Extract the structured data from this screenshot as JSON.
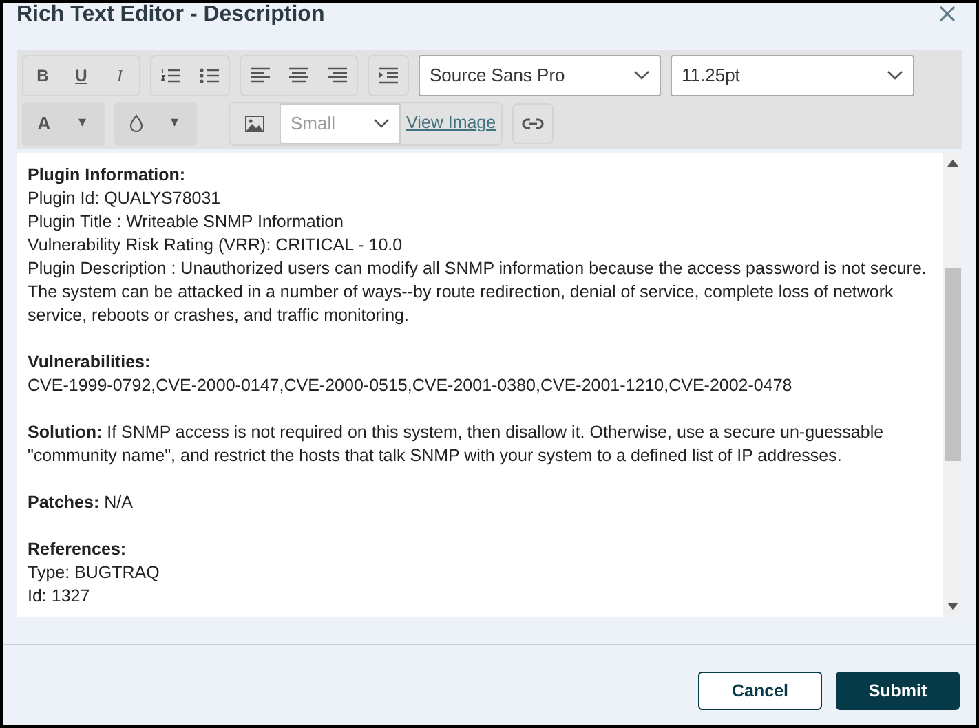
{
  "dialog": {
    "title": "Rich Text Editor - Description"
  },
  "toolbar": {
    "format_buttons": [
      {
        "label": "B",
        "kind": "bold"
      },
      {
        "label": "U",
        "kind": "underline"
      },
      {
        "label": "I",
        "kind": "italic"
      }
    ],
    "font": {
      "value": "Source Sans Pro"
    },
    "size": {
      "value": "11.25pt"
    },
    "text_color": {
      "label": "A",
      "caret": "▾"
    },
    "fill_color": {
      "caret": "▾"
    },
    "image_size": {
      "value": "Small",
      "disabled": true
    },
    "view_image_link": "View Image"
  },
  "content": [
    {
      "kind": "heading",
      "text": "Plugin Information:"
    },
    {
      "kind": "line",
      "text": "Plugin Id: QUALYS78031"
    },
    {
      "kind": "line",
      "text": "Plugin Title : Writeable SNMP Information"
    },
    {
      "kind": "line",
      "text": "Vulnerability Risk Rating (VRR): CRITICAL - 10.0"
    },
    {
      "kind": "line",
      "text": "Plugin Description : Unauthorized users can modify all SNMP information because the access password is not secure. The system can be attacked in a number of ways--by route redirection, denial of service, complete loss of network service, reboots or crashes, and traffic monitoring."
    },
    {
      "kind": "gap"
    },
    {
      "kind": "heading",
      "text": "Vulnerabilities:"
    },
    {
      "kind": "line",
      "text": "CVE-1999-0792,CVE-2000-0147,CVE-2000-0515,CVE-2001-0380,CVE-2001-1210,CVE-2002-0478"
    },
    {
      "kind": "gap"
    },
    {
      "kind": "line",
      "text": "**Solution:** If SNMP access is not required on this system, then disallow it. Otherwise, use a secure un-guessable \"community name\", and restrict the hosts that talk SNMP with your system to a defined list of IP addresses."
    },
    {
      "kind": "gap"
    },
    {
      "kind": "line",
      "text": "**Patches:** N/A"
    },
    {
      "kind": "gap"
    },
    {
      "kind": "heading",
      "text": "References:"
    },
    {
      "kind": "line",
      "text": "Type: BUGTRAQ"
    },
    {
      "kind": "line",
      "text": "Id: 1327"
    }
  ],
  "buttons": [
    {
      "label": "Cancel",
      "kind": "secondary"
    },
    {
      "label": "Submit",
      "kind": "primary"
    }
  ]
}
